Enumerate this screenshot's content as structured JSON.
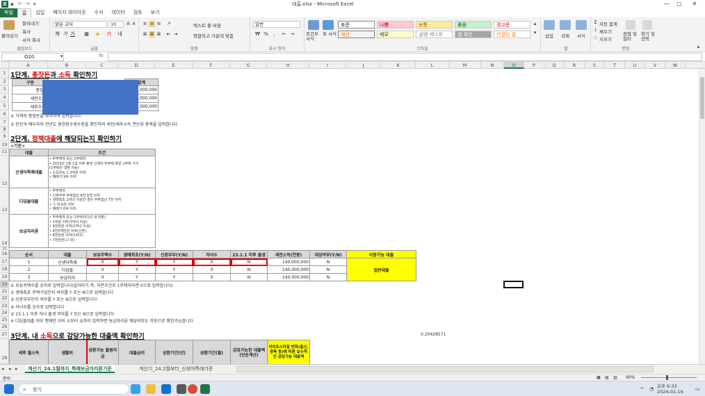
{
  "window": {
    "title": "대출.xlsx  -  Microsoft Excel",
    "min": "—",
    "max": "▢",
    "close": "✕"
  },
  "ribbon": {
    "tabs": [
      "파일",
      "홈",
      "삽입",
      "페이지 레이아웃",
      "수식",
      "데이터",
      "검토",
      "보기"
    ],
    "clipboard": {
      "paste": "붙여넣기",
      "cut": "잘라내기",
      "copy": "복사",
      "format_painter": "서식 복사",
      "label": "클립보드"
    },
    "font": {
      "name": "맑은 고딕",
      "size": "10",
      "label": "글꼴"
    },
    "align": {
      "wrap": "텍스트 줄 바꿈",
      "merge": "병합하고 가운데 맞춤",
      "label": "맞춤"
    },
    "number": {
      "format": "일반",
      "label": "표시 형식"
    },
    "styles": {
      "cond": "조건부 서식",
      "table": "표 서식",
      "cells": [
        "표준",
        "나쁨",
        "보통",
        "좋음",
        "경고문",
        "계산",
        "메모",
        "설명 텍스트",
        "셀 확인",
        "연결된 셀"
      ],
      "label": "스타일"
    },
    "cells": {
      "insert": "삽입",
      "delete": "삭제",
      "format": "서식",
      "label": "셀"
    },
    "editing": {
      "autosum": "자동 합계",
      "fill": "채우기",
      "clear": "지우기",
      "sort": "정렬 및 필터",
      "find": "찾기 및 선택",
      "label": "편집"
    }
  },
  "formula": {
    "namebox": "O20",
    "fx": "fx",
    "value": ""
  },
  "columns": [
    "A",
    "B",
    "C",
    "D",
    "E",
    "F",
    "G",
    "H",
    "I",
    "J",
    "K",
    "L",
    "M",
    "N",
    "O",
    "P",
    "Q",
    "R",
    "S",
    "T",
    "U",
    "V",
    "W"
  ],
  "rows": [
    "1",
    "2",
    "3",
    "4",
    "5",
    "6",
    "7",
    "8",
    "9",
    "10",
    "11",
    "12",
    "13",
    "14",
    "15",
    "16",
    "17",
    "18",
    "19",
    "20",
    "21",
    "22",
    "23",
    "24",
    "25",
    "26",
    "27",
    "28"
  ],
  "step1": {
    "title_pre": "1단계. ",
    "title_red1": "종잣돈",
    "title_mid": "과 ",
    "title_red2": "소득",
    "title_post": " 확인하기",
    "hdr": {
      "a": "구분",
      "total": "합계"
    },
    "rows": [
      {
        "label": "종잣돈",
        "total": "00,000,000"
      },
      {
        "label": "세전소득(",
        "total": "40,000,000"
      },
      {
        "label": "세후소득(",
        "total": "0,000,000"
      }
    ],
    "notes": [
      "① 가계의 종잣돈을 파악하여 입력합니다.",
      "② 본인과 배우자의 전년도 원천징수영수증을 확인하여 세전/세후소득 연단위 총액을 입력합니다."
    ]
  },
  "step2": {
    "title_pre": "2단계. ",
    "title_red": "정책대출",
    "title_post": "에 해당되는지 확인하기",
    "basis": "<기준>",
    "hdr": {
      "loan": "대출",
      "cond": "조건"
    },
    "loans": [
      {
        "name": "신생아특례대출",
        "conds": [
          "• 무주택자 또는 1주택자",
          "• 2023년 1월 1일 이후 출생 신생아 무주택 혹은 1주택 가구",
          "  (1주택은 대환 가능)",
          "• 소득한도 1.3억원 이하",
          "• 매매가 9억 이하"
        ]
      },
      {
        "name": "디딤돌대출",
        "conds": [
          "• 무주택자",
          "• 신혼부부 부부합산 8천 5백 이하",
          "• 생애최초 2자녀 이상인 경우 부부합산 7천 이하",
          "• 그 외 6천 이하",
          "• 매매가 6억 이하"
        ]
      },
      {
        "name": "보금자리론",
        "conds": [
          "• 무주택자 또는 1주택자(1년 내 처분)",
          "• 1억원 이하(3자녀 이상)",
          "• 9천만원 이하(2자녀 이상)",
          "• 8천5백만원 이하(신혼)",
          "• 8천만원 이하(1자녀)",
          "• 7천만원(그 외)"
        ]
      }
    ]
  },
  "calc": {
    "hdr": [
      "순서",
      "대출",
      "보유주택수",
      "생애최초(Y/N)",
      "신혼부부(Y/N)",
      "자녀수",
      "23.1.1 이후 출생",
      "세전소득(연봉)",
      "대상여부(Y/N)",
      "이용가능 대출"
    ],
    "rows": [
      {
        "no": "1",
        "loan": "신생아특례",
        "houses": "0",
        "first": "Y",
        "newly": "Y",
        "kids": "0",
        "born": "N",
        "income": "140,000,000",
        "target": "N"
      },
      {
        "no": "2",
        "loan": "디딤돌",
        "houses": "0",
        "first": "Y",
        "newly": "Y",
        "kids": "0",
        "born": "N",
        "income": "140,000,000",
        "target": "N"
      },
      {
        "no": "3",
        "loan": "보금자리",
        "houses": "0",
        "first": "Y",
        "newly": "Y",
        "kids": "0",
        "born": "N",
        "income": "140,000,000",
        "target": "N"
      }
    ],
    "result": "일반대출",
    "notes": [
      "① 보유주택수를 숫자로 입력합니다(갈아타기 즉, 처분조건부 1주택자라면 0으로 입력합니다)",
      "② 생애최초 주택구입인지 여부를 Y 또는 N으로 입력합니다",
      "③ 신혼부부인지 여부를 Y 또는 N으로 입력합니다",
      "④ 자녀수를 숫자로 입력합니다",
      "⑤ 23.1.1 이후 자녀 출생 여부를 Y 또는 N으로 입력합니다",
      "※ 디딤돌대출 여부 행에만 위의 ①부터 ⑤까지 입력하면 보금자리론 해당여부도 자동으로 확인가능합니다"
    ],
    "float_value": "0.20428571"
  },
  "step3": {
    "title_pre": "3단계. 내 ",
    "title_red": "소득",
    "title_post": "으로 감당가능한 대출액 확인하기",
    "hdr": [
      "세후 월소득",
      "생활비",
      "상환가능 월원리금",
      "대출금리",
      "상환기간(년)",
      "상환기간(월)",
      "감당가능한 대출액 (단순계산)",
      "라이프스타일 변화(출산, 양육 등)에 따른 보수적인 감당가능 대출액"
    ]
  },
  "sheet_tabs": [
    "계산기_24.1월까지_특례보금자리론기준",
    "계산기_24.2월부터_신생아특례기준"
  ],
  "status": {
    "ready": "준비",
    "zoom": "90%"
  },
  "taskbar": {
    "search": "찾기",
    "time": "오후 6:33",
    "date": "2024-01-16"
  }
}
